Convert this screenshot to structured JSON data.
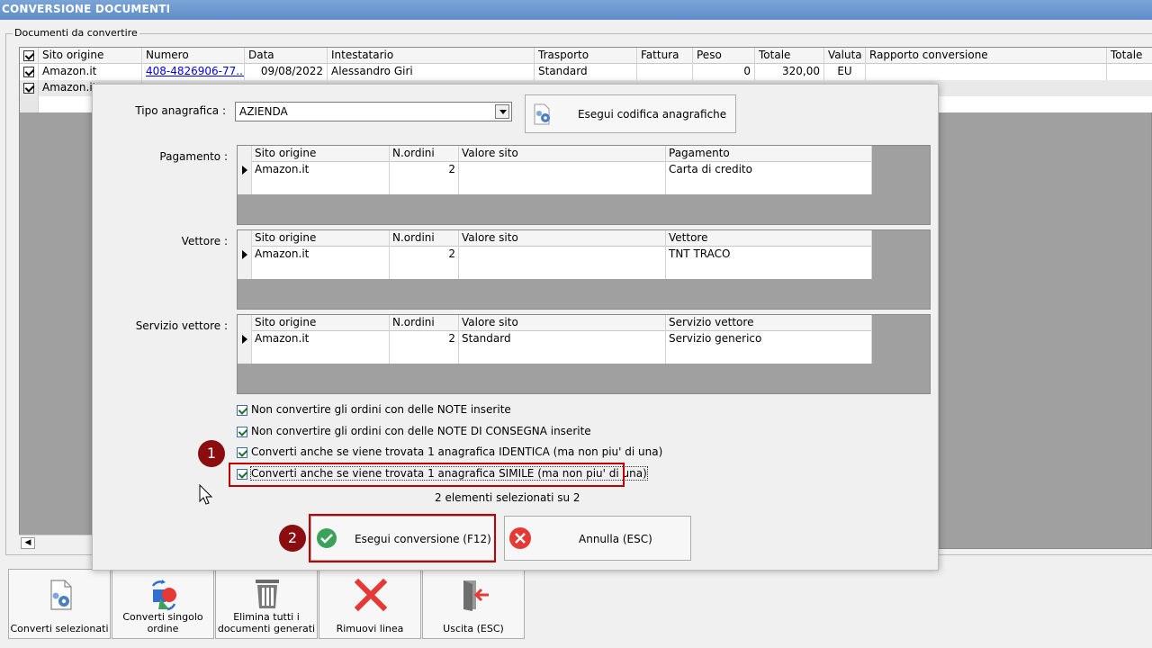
{
  "window": {
    "title": "CONVERSIONE DOCUMENTI"
  },
  "group": {
    "label": "Documenti da convertire"
  },
  "bg_table": {
    "columns": [
      "Sito origine",
      "Numero",
      "Data",
      "Intestatario",
      "Trasporto",
      "Fattura",
      "Peso",
      "Totale",
      "Valuta",
      "Rapporto conversione",
      "Totale"
    ],
    "rows": [
      {
        "sito": "Amazon.it",
        "numero": "408-4826906-77...",
        "data": "09/08/2022",
        "intestatario": "Alessandro Giri",
        "trasporto": "Standard",
        "fattura": "",
        "peso": "0",
        "totale": "320,00",
        "valuta": "EU",
        "rapporto": "",
        "totale2": ""
      },
      {
        "sito": "Amazon.it"
      }
    ]
  },
  "dialog": {
    "tipo_label": "Tipo anagrafica :",
    "tipo_value": "AZIENDA",
    "codifica_button": "Esegui codifica anagrafiche",
    "grids": [
      {
        "label": "Pagamento :",
        "columns": [
          "Sito origine",
          "N.ordini",
          "Valore sito",
          "Pagamento"
        ],
        "row": [
          "Amazon.it",
          "2",
          "",
          "Carta di credito"
        ]
      },
      {
        "label": "Vettore :",
        "columns": [
          "Sito origine",
          "N.ordini",
          "Valore sito",
          "Vettore"
        ],
        "row": [
          "Amazon.it",
          "2",
          "",
          "TNT TRACO"
        ]
      },
      {
        "label": "Servizio vettore :",
        "columns": [
          "Sito origine",
          "N.ordini",
          "Valore sito",
          "Servizio vettore"
        ],
        "row": [
          "Amazon.it",
          "2",
          "Standard",
          "Servizio generico"
        ]
      }
    ],
    "checkboxes": [
      "Non convertire gli ordini con delle NOTE inserite",
      "Non convertire gli ordini con delle NOTE DI CONSEGNA inserite",
      "Converti anche se viene trovata 1 anagrafica IDENTICA (ma non piu' di una)",
      "Converti anche se viene trovata 1 anagrafica SIMILE (ma non piu' di una)"
    ],
    "status": "2 elementi selezionati su 2",
    "ok_button": "Esegui conversione (F12)",
    "cancel_button": "Annulla (ESC)"
  },
  "badges": [
    "1",
    "2"
  ],
  "toolbar": [
    {
      "label": "Converti selezionati",
      "icon": "document-gear-icon"
    },
    {
      "label": "Converti singolo ordine",
      "icon": "convert-shapes-icon"
    },
    {
      "label": "Elimina tutti i documenti generati",
      "icon": "trash-icon"
    },
    {
      "label": "Rimuovi linea",
      "icon": "red-x-icon"
    },
    {
      "label": "Uscita (ESC)",
      "icon": "exit-door-icon"
    }
  ],
  "colors": {
    "title_bar": "#6a96d0",
    "highlight": "#c00000",
    "badge": "#8b0d10",
    "ok_green": "#3aa25a",
    "cancel_red": "#e53935"
  }
}
